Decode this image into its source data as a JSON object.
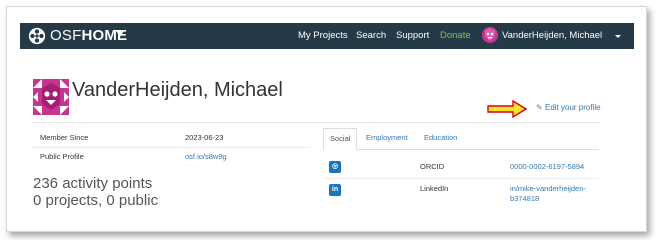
{
  "navbar": {
    "brand_osf": "OSF",
    "brand_home": "HOME",
    "links": [
      "My Projects",
      "Search",
      "Support",
      "Donate"
    ],
    "user_name": "VanderHeijden, Michael"
  },
  "profile": {
    "name": "VanderHeijden, Michael",
    "edit_label": "Edit your profile",
    "member_since_label": "Member Since",
    "member_since_value": "2023-06-23",
    "public_profile_label": "Public Profile",
    "public_profile_value": "osf.io/s8w9g",
    "activity_points": "236 activity points",
    "projects_summary": "0 projects, 0 public"
  },
  "tabs": [
    {
      "label": "Social",
      "active": true
    },
    {
      "label": "Employment",
      "active": false
    },
    {
      "label": "Education",
      "active": false
    }
  ],
  "social": [
    {
      "icon": "orcid-icon",
      "glyph": "◎",
      "name": "ORCID",
      "value": "0000-0002-6197-5894",
      "value_line2": ""
    },
    {
      "icon": "linkedin-icon",
      "glyph": "in",
      "name": "LinkedIn",
      "value": "in/mike-vanderheijden-",
      "value_line2": "b374818"
    }
  ],
  "colors": {
    "navbar_bg": "#263947",
    "link": "#337ab7",
    "donate": "#78c35b",
    "avatar": "#c6358f",
    "arrow_fill": "#f5e62a",
    "arrow_stroke": "#d9001b"
  }
}
